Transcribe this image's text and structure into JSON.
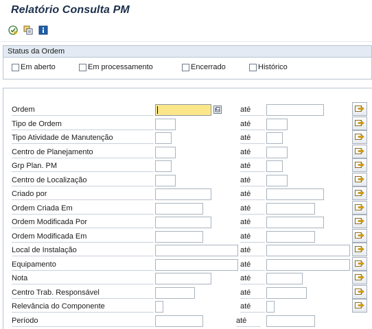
{
  "title": "Relatório Consulta PM",
  "toolbar": {
    "icons": [
      "execute-icon",
      "get-variant-icon",
      "info-icon"
    ]
  },
  "status": {
    "header": "Status da Ordem",
    "checkboxes": [
      {
        "label": "Em aberto",
        "checked": false
      },
      {
        "label": "Em processamento",
        "checked": false
      },
      {
        "label": "Encerrado",
        "checked": false
      },
      {
        "label": "Histórico",
        "checked": false
      }
    ]
  },
  "selection": {
    "to_label": "até",
    "rows": [
      {
        "label": "Ordem",
        "value_from": "",
        "value_to": ""
      },
      {
        "label": "Tipo de Ordem",
        "value_from": "",
        "value_to": ""
      },
      {
        "label": "Tipo Atividade de Manutenção",
        "value_from": "",
        "value_to": ""
      },
      {
        "label": "Centro de Planejamento",
        "value_from": "",
        "value_to": ""
      },
      {
        "label": "Grp Plan. PM",
        "value_from": "",
        "value_to": ""
      },
      {
        "label": "Centro de Localização",
        "value_from": "",
        "value_to": ""
      },
      {
        "label": "Criado por",
        "value_from": "",
        "value_to": ""
      },
      {
        "label": "Ordem Criada Em",
        "value_from": "",
        "value_to": ""
      },
      {
        "label": "Ordem Modificada Por",
        "value_from": "",
        "value_to": ""
      },
      {
        "label": "Ordem Modificada Em",
        "value_from": "",
        "value_to": ""
      },
      {
        "label": "Local de Instalação",
        "value_from": "",
        "value_to": ""
      },
      {
        "label": "Equipamento",
        "value_from": "",
        "value_to": ""
      },
      {
        "label": "Nota",
        "value_from": "",
        "value_to": ""
      },
      {
        "label": "Centro Trab. Responsável",
        "value_from": "",
        "value_to": ""
      },
      {
        "label": "Relevância do Componente",
        "value_from": "",
        "value_to": ""
      },
      {
        "label": "Período",
        "value_from": "",
        "value_to": ""
      }
    ]
  },
  "colors": {
    "title": "#1c2f4d",
    "panel_header": "#e3eaf3",
    "active_field": "#fbe78a",
    "arrow": "#e2a400"
  }
}
